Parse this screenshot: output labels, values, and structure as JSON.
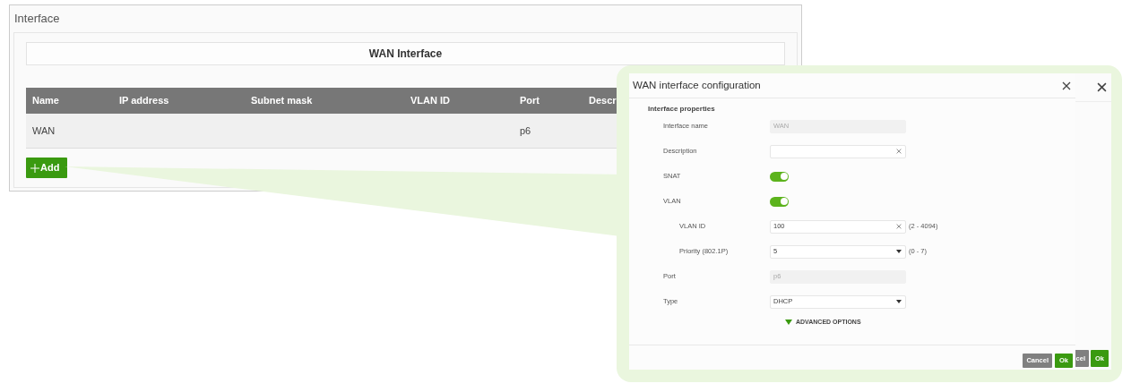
{
  "page": {
    "title": "Interface"
  },
  "section": {
    "title": "WAN Interface"
  },
  "table": {
    "columns": [
      "Name",
      "IP address",
      "Subnet mask",
      "VLAN ID",
      "Port",
      "Descr"
    ],
    "rows": [
      {
        "name": "WAN",
        "port": "p6"
      }
    ]
  },
  "add_button": {
    "label": "Add"
  },
  "back_dialog": {
    "buttons": [
      {
        "label": "cel",
        "kind": "cancel"
      },
      {
        "label": "Ok",
        "kind": "ok"
      }
    ]
  },
  "dialog": {
    "title": "WAN interface configuration",
    "section": "Interface properties",
    "fields": [
      {
        "kind": "text",
        "label": "Interface name",
        "value": "WAN",
        "disabled": true
      },
      {
        "kind": "text",
        "label": "Description",
        "clearable": true
      },
      {
        "kind": "toggle",
        "label": "SNAT",
        "on": true
      },
      {
        "kind": "toggle",
        "label": "VLAN",
        "on": true,
        "children": [
          {
            "kind": "text",
            "label": "VLAN ID",
            "value": "100",
            "clearable": true,
            "hint": "(2 - 4094)"
          },
          {
            "kind": "select",
            "label": "Priority (802.1P)",
            "value": "5",
            "hint": "(0 - 7)"
          }
        ]
      },
      {
        "kind": "text",
        "label": "Port",
        "value": "p6",
        "disabled": true
      },
      {
        "kind": "select",
        "label": "Type",
        "value": "DHCP"
      }
    ],
    "advanced": {
      "label": "ADVANCED OPTIONS"
    },
    "buttons": [
      {
        "label": "Cancel",
        "kind": "cancel"
      },
      {
        "label": "Ok",
        "kind": "ok"
      }
    ]
  }
}
